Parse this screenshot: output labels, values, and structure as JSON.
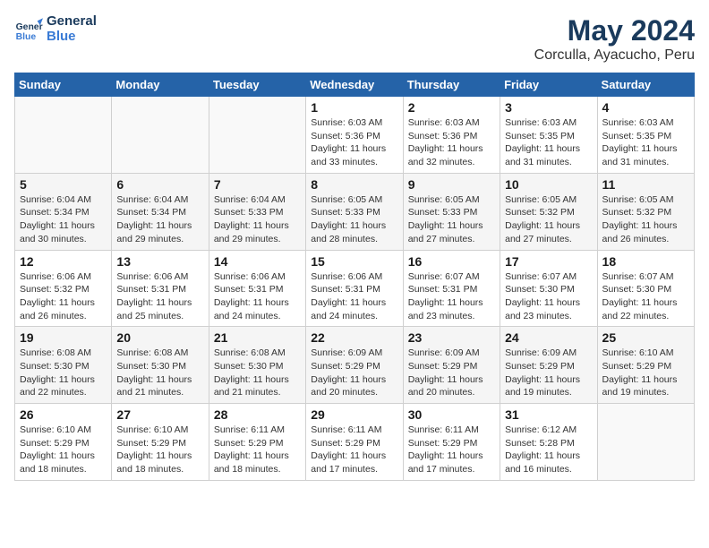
{
  "logo": {
    "line1": "General",
    "line2": "Blue"
  },
  "title": "May 2024",
  "subtitle": "Corculla, Ayacucho, Peru",
  "headers": [
    "Sunday",
    "Monday",
    "Tuesday",
    "Wednesday",
    "Thursday",
    "Friday",
    "Saturday"
  ],
  "weeks": [
    [
      {
        "day": "",
        "info": ""
      },
      {
        "day": "",
        "info": ""
      },
      {
        "day": "",
        "info": ""
      },
      {
        "day": "1",
        "info": "Sunrise: 6:03 AM\nSunset: 5:36 PM\nDaylight: 11 hours\nand 33 minutes."
      },
      {
        "day": "2",
        "info": "Sunrise: 6:03 AM\nSunset: 5:36 PM\nDaylight: 11 hours\nand 32 minutes."
      },
      {
        "day": "3",
        "info": "Sunrise: 6:03 AM\nSunset: 5:35 PM\nDaylight: 11 hours\nand 31 minutes."
      },
      {
        "day": "4",
        "info": "Sunrise: 6:03 AM\nSunset: 5:35 PM\nDaylight: 11 hours\nand 31 minutes."
      }
    ],
    [
      {
        "day": "5",
        "info": "Sunrise: 6:04 AM\nSunset: 5:34 PM\nDaylight: 11 hours\nand 30 minutes."
      },
      {
        "day": "6",
        "info": "Sunrise: 6:04 AM\nSunset: 5:34 PM\nDaylight: 11 hours\nand 29 minutes."
      },
      {
        "day": "7",
        "info": "Sunrise: 6:04 AM\nSunset: 5:33 PM\nDaylight: 11 hours\nand 29 minutes."
      },
      {
        "day": "8",
        "info": "Sunrise: 6:05 AM\nSunset: 5:33 PM\nDaylight: 11 hours\nand 28 minutes."
      },
      {
        "day": "9",
        "info": "Sunrise: 6:05 AM\nSunset: 5:33 PM\nDaylight: 11 hours\nand 27 minutes."
      },
      {
        "day": "10",
        "info": "Sunrise: 6:05 AM\nSunset: 5:32 PM\nDaylight: 11 hours\nand 27 minutes."
      },
      {
        "day": "11",
        "info": "Sunrise: 6:05 AM\nSunset: 5:32 PM\nDaylight: 11 hours\nand 26 minutes."
      }
    ],
    [
      {
        "day": "12",
        "info": "Sunrise: 6:06 AM\nSunset: 5:32 PM\nDaylight: 11 hours\nand 26 minutes."
      },
      {
        "day": "13",
        "info": "Sunrise: 6:06 AM\nSunset: 5:31 PM\nDaylight: 11 hours\nand 25 minutes."
      },
      {
        "day": "14",
        "info": "Sunrise: 6:06 AM\nSunset: 5:31 PM\nDaylight: 11 hours\nand 24 minutes."
      },
      {
        "day": "15",
        "info": "Sunrise: 6:06 AM\nSunset: 5:31 PM\nDaylight: 11 hours\nand 24 minutes."
      },
      {
        "day": "16",
        "info": "Sunrise: 6:07 AM\nSunset: 5:31 PM\nDaylight: 11 hours\nand 23 minutes."
      },
      {
        "day": "17",
        "info": "Sunrise: 6:07 AM\nSunset: 5:30 PM\nDaylight: 11 hours\nand 23 minutes."
      },
      {
        "day": "18",
        "info": "Sunrise: 6:07 AM\nSunset: 5:30 PM\nDaylight: 11 hours\nand 22 minutes."
      }
    ],
    [
      {
        "day": "19",
        "info": "Sunrise: 6:08 AM\nSunset: 5:30 PM\nDaylight: 11 hours\nand 22 minutes."
      },
      {
        "day": "20",
        "info": "Sunrise: 6:08 AM\nSunset: 5:30 PM\nDaylight: 11 hours\nand 21 minutes."
      },
      {
        "day": "21",
        "info": "Sunrise: 6:08 AM\nSunset: 5:30 PM\nDaylight: 11 hours\nand 21 minutes."
      },
      {
        "day": "22",
        "info": "Sunrise: 6:09 AM\nSunset: 5:29 PM\nDaylight: 11 hours\nand 20 minutes."
      },
      {
        "day": "23",
        "info": "Sunrise: 6:09 AM\nSunset: 5:29 PM\nDaylight: 11 hours\nand 20 minutes."
      },
      {
        "day": "24",
        "info": "Sunrise: 6:09 AM\nSunset: 5:29 PM\nDaylight: 11 hours\nand 19 minutes."
      },
      {
        "day": "25",
        "info": "Sunrise: 6:10 AM\nSunset: 5:29 PM\nDaylight: 11 hours\nand 19 minutes."
      }
    ],
    [
      {
        "day": "26",
        "info": "Sunrise: 6:10 AM\nSunset: 5:29 PM\nDaylight: 11 hours\nand 18 minutes."
      },
      {
        "day": "27",
        "info": "Sunrise: 6:10 AM\nSunset: 5:29 PM\nDaylight: 11 hours\nand 18 minutes."
      },
      {
        "day": "28",
        "info": "Sunrise: 6:11 AM\nSunset: 5:29 PM\nDaylight: 11 hours\nand 18 minutes."
      },
      {
        "day": "29",
        "info": "Sunrise: 6:11 AM\nSunset: 5:29 PM\nDaylight: 11 hours\nand 17 minutes."
      },
      {
        "day": "30",
        "info": "Sunrise: 6:11 AM\nSunset: 5:29 PM\nDaylight: 11 hours\nand 17 minutes."
      },
      {
        "day": "31",
        "info": "Sunrise: 6:12 AM\nSunset: 5:28 PM\nDaylight: 11 hours\nand 16 minutes."
      },
      {
        "day": "",
        "info": ""
      }
    ]
  ]
}
